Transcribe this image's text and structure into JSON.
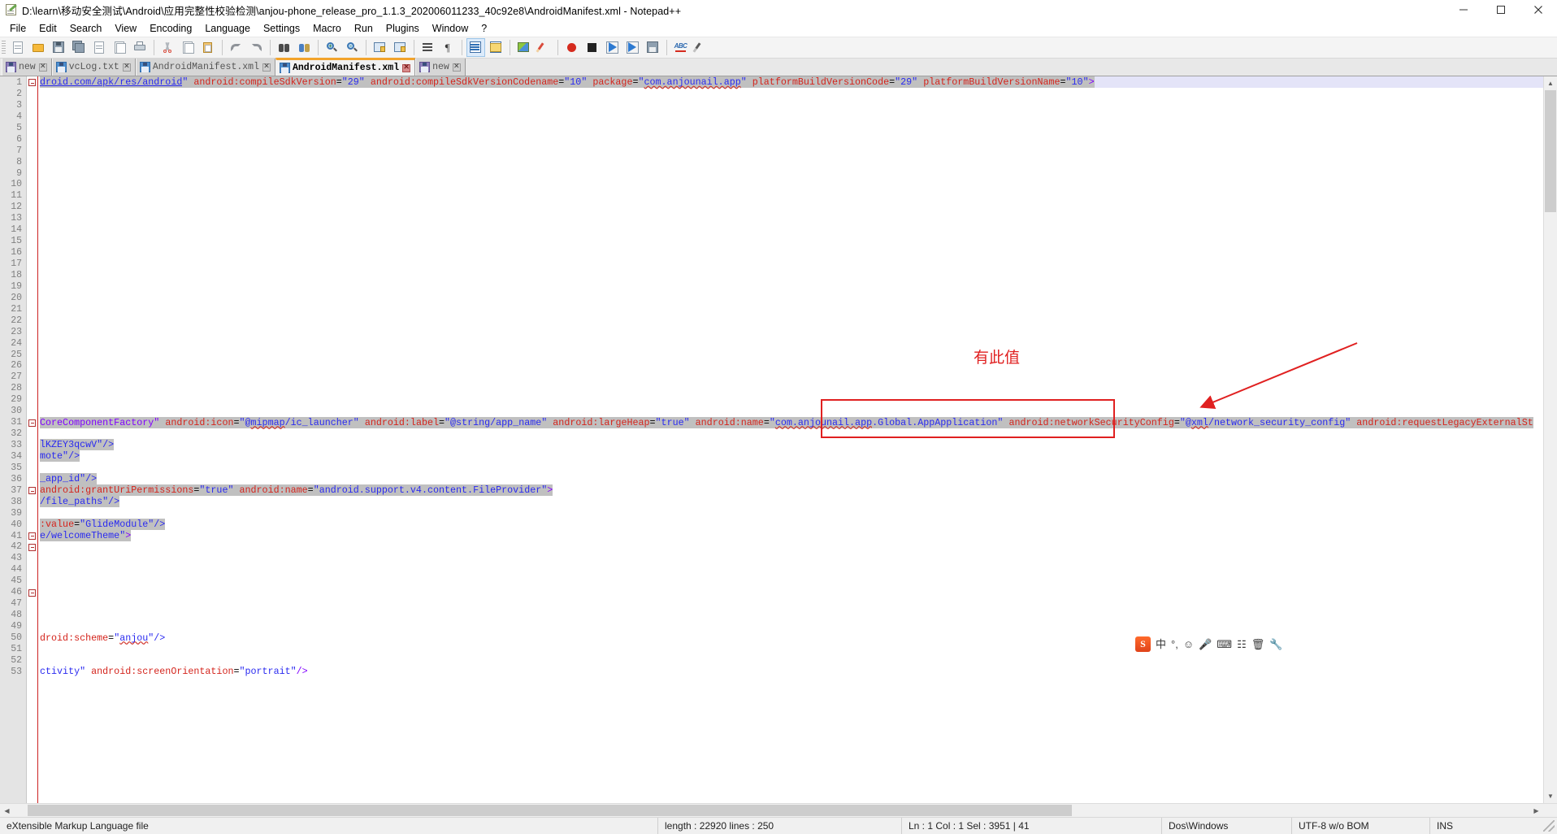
{
  "window": {
    "title": "D:\\learn\\移动安全测试\\Android\\应用完整性校验检测\\anjou-phone_release_pro_1.1.3_202006011233_40c92e8\\AndroidManifest.xml - Notepad++",
    "minimize_label": "–",
    "maximize_label": "□",
    "close_label": "✕"
  },
  "menu": {
    "items": [
      {
        "label": "File"
      },
      {
        "label": "Edit"
      },
      {
        "label": "Search"
      },
      {
        "label": "View"
      },
      {
        "label": "Encoding"
      },
      {
        "label": "Language"
      },
      {
        "label": "Settings"
      },
      {
        "label": "Macro"
      },
      {
        "label": "Run"
      },
      {
        "label": "Plugins"
      },
      {
        "label": "Window"
      },
      {
        "label": "?"
      }
    ]
  },
  "toolbar": {
    "buttons": [
      {
        "name": "new-file",
        "icon": "new-document-icon"
      },
      {
        "name": "open-file",
        "icon": "open-folder-icon"
      },
      {
        "name": "save",
        "icon": "save-disk-icon"
      },
      {
        "name": "save-all",
        "icon": "save-all-icon"
      },
      {
        "name": "close",
        "icon": "close-document-icon"
      },
      {
        "name": "close-all",
        "icon": "close-all-documents-icon"
      },
      {
        "name": "print",
        "icon": "printer-icon"
      },
      {
        "name": "cut",
        "icon": "scissors-icon"
      },
      {
        "name": "copy",
        "icon": "copy-icon"
      },
      {
        "name": "paste",
        "icon": "paste-clipboard-icon"
      },
      {
        "name": "undo",
        "icon": "undo-arrow-icon"
      },
      {
        "name": "redo",
        "icon": "redo-arrow-icon"
      },
      {
        "name": "find",
        "icon": "binoculars-icon"
      },
      {
        "name": "replace",
        "icon": "replace-icon"
      },
      {
        "name": "zoom-in",
        "icon": "magnifier-plus-icon"
      },
      {
        "name": "zoom-out",
        "icon": "magnifier-minus-icon"
      },
      {
        "name": "sync-vertical",
        "icon": "sync-vertical-scroll-icon"
      },
      {
        "name": "sync-horizontal",
        "icon": "sync-horizontal-scroll-icon"
      },
      {
        "name": "word-wrap",
        "icon": "word-wrap-icon"
      },
      {
        "name": "show-all-characters",
        "icon": "pilcrow-icon"
      },
      {
        "name": "show-indent-guide",
        "icon": "indent-guide-icon"
      },
      {
        "name": "user-defined-dialog",
        "icon": "user-language-icon"
      },
      {
        "name": "document-map",
        "icon": "document-map-icon"
      },
      {
        "name": "function-list",
        "icon": "function-list-icon"
      },
      {
        "name": "start-recording",
        "icon": "record-icon"
      },
      {
        "name": "stop-recording",
        "icon": "stop-icon"
      },
      {
        "name": "playback",
        "icon": "play-icon"
      },
      {
        "name": "run-macro-multiple",
        "icon": "play-multiple-icon"
      },
      {
        "name": "save-macro",
        "icon": "save-macro-icon"
      },
      {
        "name": "spell-check",
        "icon": "abc-spellcheck-icon"
      },
      {
        "name": "run",
        "icon": "run-icon"
      }
    ]
  },
  "tabs": [
    {
      "label": "new",
      "icon_color": "purple",
      "active": false
    },
    {
      "label": "vcLog.txt",
      "icon_color": "blue",
      "active": false
    },
    {
      "label": "AndroidManifest.xml",
      "icon_color": "blue",
      "active": false
    },
    {
      "label": "AndroidManifest.xml",
      "icon_color": "blue",
      "active": true
    },
    {
      "label": "new",
      "icon_color": "purple",
      "active": false
    }
  ],
  "editor": {
    "first_line_number": 1,
    "total_visible_lines": 53,
    "lines": [
      {
        "n": 1,
        "fold": true,
        "segments": [
          {
            "t": "droid.com/apk/res/android",
            "c": "link sel"
          },
          {
            "t": "\"",
            "c": "val sel"
          },
          {
            "t": " ",
            "c": "plain sel"
          },
          {
            "t": "android:compileSdkVersion",
            "c": "attr sel"
          },
          {
            "t": "=",
            "c": "eq sel"
          },
          {
            "t": "\"29\"",
            "c": "val sel"
          },
          {
            "t": " ",
            "c": "plain sel"
          },
          {
            "t": "android:compileSdkVersionCodename",
            "c": "attr sel"
          },
          {
            "t": "=",
            "c": "eq sel"
          },
          {
            "t": "\"10\"",
            "c": "val sel"
          },
          {
            "t": " ",
            "c": "plain sel"
          },
          {
            "t": "package",
            "c": "attr sel"
          },
          {
            "t": "=",
            "c": "eq sel"
          },
          {
            "t": "\"",
            "c": "val sel"
          },
          {
            "t": "com.anjounail.app",
            "c": "val wavy sel"
          },
          {
            "t": "\"",
            "c": "val sel"
          },
          {
            "t": " ",
            "c": "plain sel"
          },
          {
            "t": "platformBuildVersionCode",
            "c": "attr sel"
          },
          {
            "t": "=",
            "c": "eq sel"
          },
          {
            "t": "\"29\"",
            "c": "val sel"
          },
          {
            "t": " ",
            "c": "plain sel"
          },
          {
            "t": "platformBuildVersionName",
            "c": "attr sel"
          },
          {
            "t": "=",
            "c": "eq sel"
          },
          {
            "t": "\"10\"",
            "c": "val sel"
          },
          {
            "t": ">",
            "c": "tag sel"
          },
          {
            "t": "                                                                                                                                      ",
            "c": "first"
          }
        ]
      },
      {
        "n": 31,
        "fold": true,
        "segments": [
          {
            "t": "CoreComponentFactory\"",
            "c": "tag sel"
          },
          {
            "t": " ",
            "c": "plain sel"
          },
          {
            "t": "android:icon",
            "c": "attr sel"
          },
          {
            "t": "=",
            "c": "eq sel"
          },
          {
            "t": "\"@",
            "c": "val sel"
          },
          {
            "t": "mipmap",
            "c": "val wavy sel"
          },
          {
            "t": "/ic_launcher\"",
            "c": "val sel"
          },
          {
            "t": " ",
            "c": "plain sel"
          },
          {
            "t": "android:label",
            "c": "attr sel"
          },
          {
            "t": "=",
            "c": "eq sel"
          },
          {
            "t": "\"@string/app_name\"",
            "c": "val sel"
          },
          {
            "t": " ",
            "c": "plain sel"
          },
          {
            "t": "android:largeHeap",
            "c": "attr sel"
          },
          {
            "t": "=",
            "c": "eq sel"
          },
          {
            "t": "\"true\"",
            "c": "val sel"
          },
          {
            "t": " ",
            "c": "plain sel"
          },
          {
            "t": "android:name",
            "c": "attr sel"
          },
          {
            "t": "=",
            "c": "eq sel"
          },
          {
            "t": "\"",
            "c": "val sel"
          },
          {
            "t": "com.anjounail.app",
            "c": "val wavy sel"
          },
          {
            "t": ".Global.AppApplication",
            "c": "val sel"
          },
          {
            "t": "\"",
            "c": "val sel"
          },
          {
            "t": " ",
            "c": "plain sel"
          },
          {
            "t": "android:networkSecurityConfig",
            "c": "attr sel"
          },
          {
            "t": "=",
            "c": "eq sel"
          },
          {
            "t": "\"@",
            "c": "val sel"
          },
          {
            "t": "xml",
            "c": "val wavy sel"
          },
          {
            "t": "/network_security_config\"",
            "c": "val sel"
          },
          {
            "t": " ",
            "c": "plain sel"
          },
          {
            "t": "android:requestLegacyExternalSt",
            "c": "attr sel"
          }
        ]
      },
      {
        "n": 33,
        "fold": false,
        "segments": [
          {
            "t": "lKZEY3qcwV\"/>",
            "c": "val sel"
          }
        ]
      },
      {
        "n": 34,
        "fold": false,
        "segments": [
          {
            "t": "mote\"/>",
            "c": "val sel"
          }
        ]
      },
      {
        "n": 36,
        "fold": false,
        "segments": [
          {
            "t": "_app_id\"/>",
            "c": "val sel"
          }
        ]
      },
      {
        "n": 37,
        "fold": true,
        "segments": [
          {
            "t": "android:grantUriPermissions",
            "c": "attr sel"
          },
          {
            "t": "=",
            "c": "eq sel"
          },
          {
            "t": "\"true\"",
            "c": "val sel"
          },
          {
            "t": " ",
            "c": "plain sel"
          },
          {
            "t": "android:name",
            "c": "attr sel"
          },
          {
            "t": "=",
            "c": "eq sel"
          },
          {
            "t": "\"android.support.v4.content.FileProvider\"",
            "c": "val sel"
          },
          {
            "t": ">",
            "c": "tag sel"
          }
        ]
      },
      {
        "n": 38,
        "fold": false,
        "segments": [
          {
            "t": "/file_paths\"/>",
            "c": "val sel"
          }
        ]
      },
      {
        "n": 40,
        "fold": false,
        "segments": [
          {
            "t": ":value",
            "c": "attr sel"
          },
          {
            "t": "=",
            "c": "eq sel"
          },
          {
            "t": "\"GlideModule\"/>",
            "c": "val sel"
          }
        ]
      },
      {
        "n": 41,
        "fold": true,
        "segments": [
          {
            "t": "e/welcomeTheme\"",
            "c": "val sel"
          },
          {
            "t": ">",
            "c": "tag sel"
          }
        ]
      },
      {
        "n": 42,
        "fold": true,
        "segments": []
      },
      {
        "n": 46,
        "fold": true,
        "segments": []
      },
      {
        "n": 50,
        "fold": false,
        "segments": [
          {
            "t": "droid:scheme",
            "c": "attr"
          },
          {
            "t": "=",
            "c": "eq"
          },
          {
            "t": "\"",
            "c": "val"
          },
          {
            "t": "anjou",
            "c": "val wavy"
          },
          {
            "t": "\"/>",
            "c": "val"
          }
        ]
      },
      {
        "n": 53,
        "fold": false,
        "segments": [
          {
            "t": "ctivity\"",
            "c": "val"
          },
          {
            "t": " ",
            "c": "plain"
          },
          {
            "t": "android:screenOrientation",
            "c": "attr"
          },
          {
            "t": "=",
            "c": "eq"
          },
          {
            "t": "\"portrait\"",
            "c": "val"
          },
          {
            "t": "/>",
            "c": "tag"
          }
        ]
      }
    ]
  },
  "annotation": {
    "label": "有此值",
    "box_color": "#e02020",
    "arrow_color": "#e02020"
  },
  "ime": {
    "logo": "S",
    "items": [
      "中",
      "°,",
      "☺",
      "🎤",
      "⌨",
      "☷",
      "🗑",
      "🔧"
    ]
  },
  "statusbar": {
    "doc_type": "eXtensible Markup Language file",
    "length_lines": "length : 22920    lines : 250",
    "position": "Ln : 1    Col : 1    Sel : 3951 | 41",
    "eol": "Dos\\Windows",
    "encoding": "UTF-8 w/o BOM",
    "insert_mode": "INS"
  },
  "colors": {
    "tab_active_accent": "#f2a32b",
    "attribute": "#d4241c",
    "value": "#2a2af0",
    "tag": "#8000ff",
    "selection": "#c0c0c0",
    "annotation": "#e02020"
  }
}
